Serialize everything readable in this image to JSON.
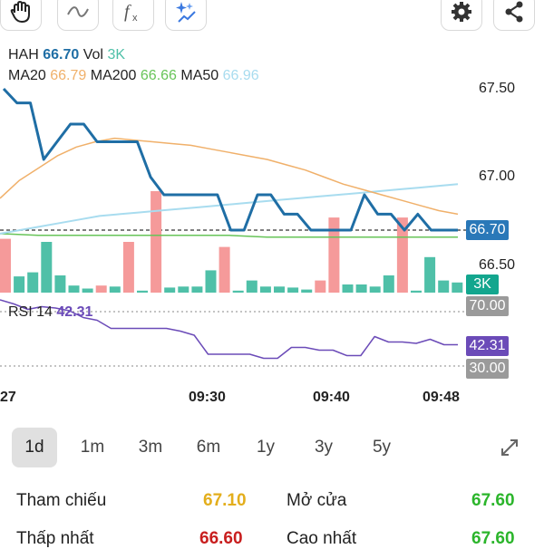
{
  "toolbar": {
    "icons": [
      "hand-draw-icon",
      "curve-icon",
      "formula-icon",
      "ai-sparkle-icon",
      "settings-gear-icon",
      "share-icon"
    ]
  },
  "legend": {
    "symbol": "HAH",
    "price": "66.70",
    "vol_label": "Vol",
    "vol": "3K",
    "ma20_label": "MA20",
    "ma20": "66.79",
    "ma200_label": "MA200",
    "ma200": "66.66",
    "ma50_label": "MA50",
    "ma50": "66.96"
  },
  "rsi": {
    "label": "RSI 14",
    "value": "42.31"
  },
  "colors": {
    "price_line": "#1f6ea5",
    "ma20": "#f0b06a",
    "ma200": "#67c458",
    "ma50": "#a8dcef",
    "vol_up": "#4fc0a8",
    "vol_down": "#f59a9a",
    "rsi": "#6b4bb8",
    "price_pill": "#2a78b8",
    "vol_pill": "#13a68e",
    "rsi_pill": "#6b4bb8",
    "level_pill": "#9a9a9a",
    "ref": "#e3ae1c",
    "low": "#c81e1e",
    "high": "#2bb52b"
  },
  "axis": {
    "y_ticks": [
      "67.50",
      "67.00",
      "66.50"
    ],
    "price_tag": "66.70",
    "volume_tag": "3K",
    "rsi_upper": "70.00",
    "rsi_value_tag": "42.31",
    "rsi_lower": "30.00",
    "x_ticks": [
      "27",
      "09:30",
      "09:40",
      "09:48"
    ]
  },
  "ranges": {
    "items": [
      "1d",
      "1m",
      "3m",
      "6m",
      "1y",
      "3y",
      "5y"
    ],
    "active": "1d",
    "expand_icon": "expand-arrows-icon"
  },
  "info": {
    "ref_label": "Tham chiếu",
    "ref_value": "67.10",
    "open_label": "Mở cửa",
    "open_value": "67.60",
    "low_label": "Thấp nhất",
    "low_value": "66.60",
    "high_label": "Cao nhất",
    "high_value": "67.60"
  },
  "chart_data": {
    "type": "line",
    "price_axis": {
      "ylim": [
        66.35,
        67.55
      ]
    },
    "price_series": {
      "name": "HAH",
      "values": [
        67.5,
        67.42,
        67.42,
        67.1,
        67.2,
        67.3,
        67.3,
        67.2,
        67.2,
        67.2,
        67.2,
        67.0,
        66.9,
        66.9,
        66.9,
        66.9,
        66.9,
        66.7,
        66.7,
        66.9,
        66.9,
        66.79,
        66.79,
        66.7,
        66.7,
        66.7,
        66.7,
        66.9,
        66.79,
        66.79,
        66.7,
        66.79,
        66.7,
        66.7,
        66.7
      ]
    },
    "ma20": [
      66.88,
      66.98,
      67.05,
      67.12,
      67.17,
      67.2,
      67.22,
      67.21,
      67.2,
      67.19,
      67.18,
      67.16,
      67.14,
      67.12,
      67.1,
      67.07,
      67.04,
      67.0,
      66.96,
      66.93,
      66.9,
      66.87,
      66.84,
      66.81,
      66.79
    ],
    "ma50": [
      66.68,
      66.7,
      66.72,
      66.74,
      66.76,
      66.78,
      66.79,
      66.8,
      66.81,
      66.82,
      66.83,
      66.84,
      66.85,
      66.86,
      66.87,
      66.88,
      66.89,
      66.9,
      66.91,
      66.92,
      66.93,
      66.94,
      66.95,
      66.96
    ],
    "ma200": [
      66.68,
      66.67,
      66.67,
      66.67,
      66.67,
      66.67,
      66.67,
      66.66,
      66.66,
      66.66,
      66.66,
      66.66,
      66.66
    ],
    "volume": [
      {
        "v": 5.3,
        "dir": "down"
      },
      {
        "v": 1.6,
        "dir": "up"
      },
      {
        "v": 2.0,
        "dir": "up"
      },
      {
        "v": 5.0,
        "dir": "up"
      },
      {
        "v": 1.7,
        "dir": "up"
      },
      {
        "v": 0.7,
        "dir": "up"
      },
      {
        "v": 0.4,
        "dir": "up"
      },
      {
        "v": 0.7,
        "dir": "down"
      },
      {
        "v": 0.6,
        "dir": "up"
      },
      {
        "v": 5.0,
        "dir": "down"
      },
      {
        "v": 0.2,
        "dir": "up"
      },
      {
        "v": 10.0,
        "dir": "down"
      },
      {
        "v": 0.5,
        "dir": "up"
      },
      {
        "v": 0.6,
        "dir": "up"
      },
      {
        "v": 0.6,
        "dir": "up"
      },
      {
        "v": 2.2,
        "dir": "up"
      },
      {
        "v": 4.5,
        "dir": "down"
      },
      {
        "v": 0.2,
        "dir": "up"
      },
      {
        "v": 1.2,
        "dir": "up"
      },
      {
        "v": 0.6,
        "dir": "up"
      },
      {
        "v": 0.6,
        "dir": "up"
      },
      {
        "v": 0.5,
        "dir": "up"
      },
      {
        "v": 0.3,
        "dir": "up"
      },
      {
        "v": 1.2,
        "dir": "down"
      },
      {
        "v": 7.4,
        "dir": "down"
      },
      {
        "v": 0.8,
        "dir": "up"
      },
      {
        "v": 0.8,
        "dir": "up"
      },
      {
        "v": 0.6,
        "dir": "up"
      },
      {
        "v": 1.7,
        "dir": "up"
      },
      {
        "v": 7.4,
        "dir": "down"
      },
      {
        "v": 0.2,
        "dir": "up"
      },
      {
        "v": 3.5,
        "dir": "up"
      },
      {
        "v": 1.2,
        "dir": "up"
      },
      {
        "v": 1.0,
        "dir": "up"
      }
    ],
    "rsi_series": [
      75,
      72,
      68,
      70,
      69,
      67,
      62,
      60,
      54,
      54,
      54,
      54,
      54,
      52,
      49,
      35,
      35,
      35,
      35,
      32,
      32,
      40,
      40,
      38,
      38,
      34,
      34,
      48,
      44,
      44,
      43,
      46,
      42,
      42
    ],
    "rsi_axis": {
      "ylim": [
        0,
        100
      ],
      "levels": [
        70,
        30
      ]
    }
  }
}
